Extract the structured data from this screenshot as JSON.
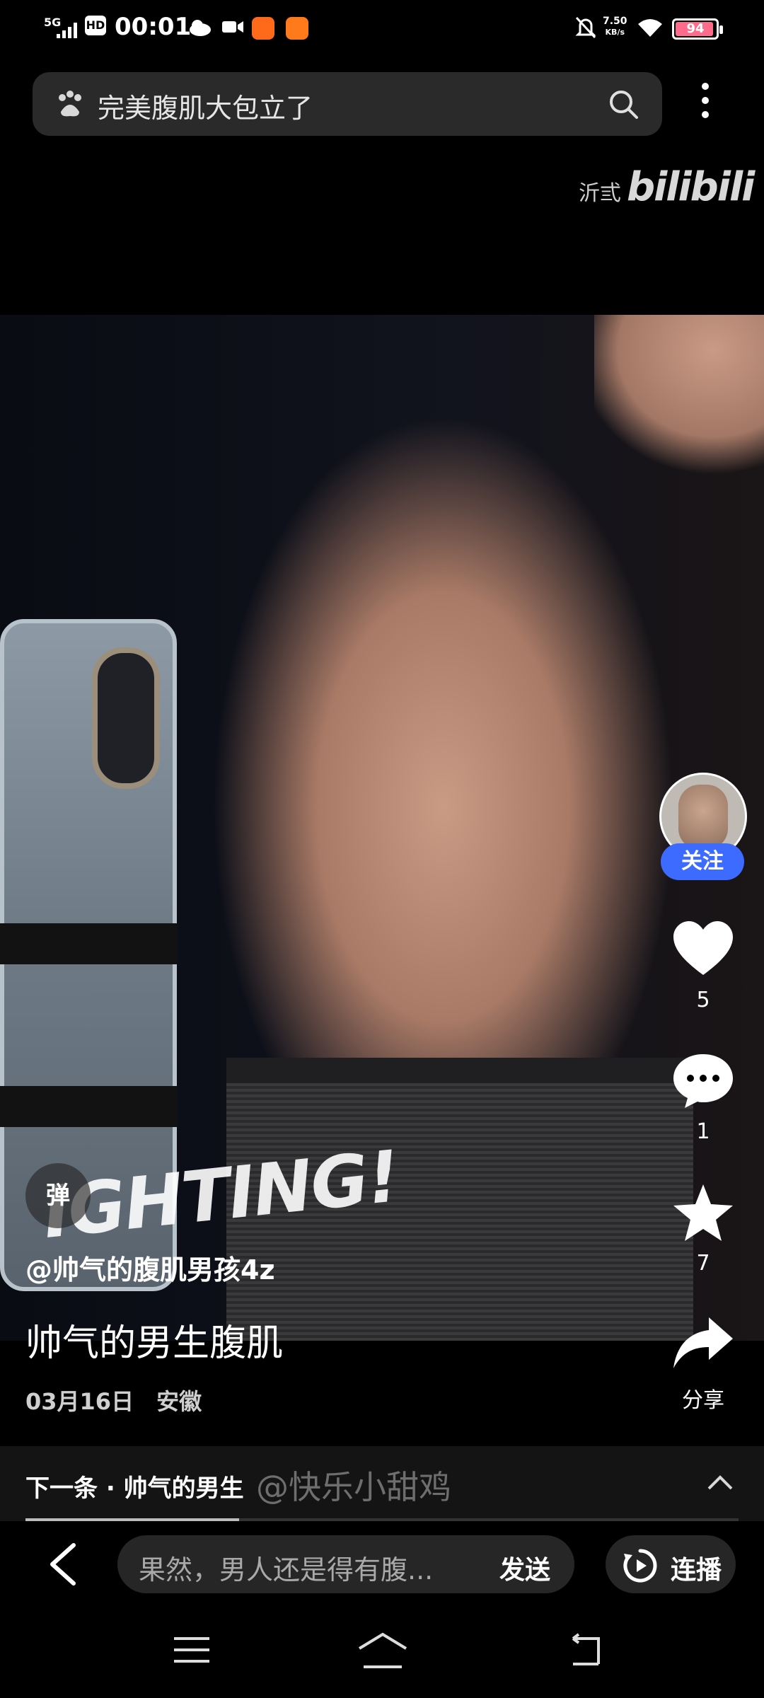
{
  "status_bar": {
    "network": "5G",
    "hd": "HD",
    "time": "00:01",
    "speed_value": "7.50",
    "speed_unit": "KB/s",
    "battery": "94",
    "battery_level": 0.94
  },
  "search": {
    "query": "完美腹肌大包立了"
  },
  "watermark": {
    "prefix": "沂弎",
    "brand": "bilibili"
  },
  "video": {
    "overlay_text": "IGHTING!"
  },
  "overlay": {
    "danmu": "弹",
    "author": "@帅气的腹肌男孩4z",
    "caption": "帅气的男生腹肌",
    "date": "03月16日",
    "location": "安徽"
  },
  "rail": {
    "follow": "关注",
    "likes": "5",
    "comments": "1",
    "favorites": "7",
    "share": "分享"
  },
  "next": {
    "label": "下一条 · 帅气的男生",
    "watermark": "@快乐小甜鸡"
  },
  "progress": 0.3,
  "comment_bar": {
    "placeholder": "果然，男人还是得有腹...",
    "send": "发送",
    "autoplay": "连播"
  },
  "colors": {
    "follow": "#3d6bff",
    "battery": "#ff6b8b"
  },
  "icons": [
    "paw-icon",
    "search-icon",
    "more-icon",
    "heart-icon",
    "comment-icon",
    "star-icon",
    "share-icon",
    "chevron-up-icon",
    "back-icon",
    "autoplay-icon",
    "menu-icon",
    "home-icon",
    "nav-back-icon"
  ]
}
